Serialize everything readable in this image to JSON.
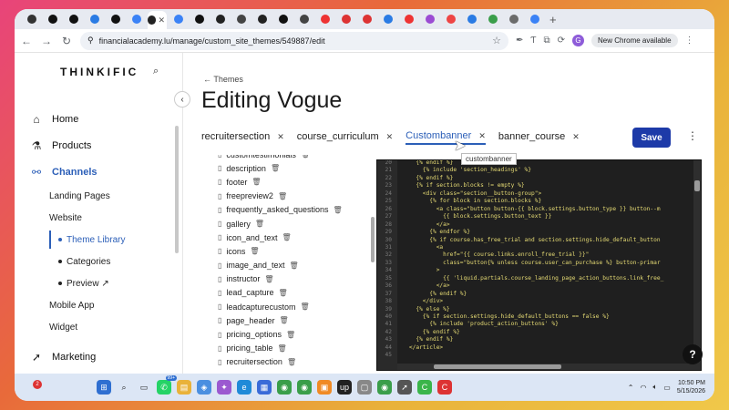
{
  "browser": {
    "url": "financialacademy.lu/manage/custom_site_themes/549887/edit",
    "new_chrome_label": "New Chrome available",
    "profile_initial": "G",
    "tab_favicons": [
      "#333",
      "#111",
      "#111",
      "#2a7be4",
      "#111",
      "#3b82f6",
      "#222",
      "#3b82f6",
      "#111",
      "#222",
      "#444",
      "#222",
      "#111",
      "#444",
      "#e33",
      "#d33",
      "#d33",
      "#2a7be4",
      "#e33",
      "#9b4bd3",
      "#e44",
      "#2a7be4",
      "#3a9e4a",
      "#6b6b6b",
      "#3b82f6"
    ]
  },
  "sidebar": {
    "logo": "THINKIFIC",
    "items": [
      {
        "label": "Home",
        "icon": "home-icon",
        "glyph": "⌂"
      },
      {
        "label": "Products",
        "icon": "products-icon",
        "glyph": "⚗"
      },
      {
        "label": "Channels",
        "icon": "channels-icon",
        "glyph": "⚯"
      }
    ],
    "channels_sub": [
      "Landing Pages",
      "Website"
    ],
    "website_sub": [
      "Theme Library",
      "Categories",
      "Preview ↗"
    ],
    "channels_sub_after": [
      "Mobile App",
      "Widget"
    ],
    "marketing": {
      "label": "Marketing",
      "glyph": "➚"
    }
  },
  "main": {
    "breadcrumb": "← Themes",
    "title": "Editing Vogue",
    "tabs": [
      "recruitersection",
      "course_curriculum",
      "Custombanner",
      "banner_course"
    ],
    "active_tab": 2,
    "save_label": "Save",
    "tooltip": "custombanner",
    "files": [
      "customtestimonials",
      "description",
      "footer",
      "freepreview2",
      "frequently_asked_questions",
      "gallery",
      "icon_and_text",
      "icons",
      "image_and_text",
      "instructor",
      "lead_capture",
      "leadcapturecustom",
      "page_header",
      "pricing_options",
      "pricing_table",
      "recruitersection"
    ],
    "code_lines": [
      {
        "n": "20",
        "t": "      {% endif %}"
      },
      {
        "n": "21",
        "t": "        {% include 'section_headings' %}"
      },
      {
        "n": "22",
        "t": "      {% endif %}"
      },
      {
        "n": "23",
        "t": "      {% if section.blocks != empty %}"
      },
      {
        "n": "24",
        "t": "        <div class=\"section__button-group\">"
      },
      {
        "n": "25",
        "t": "          {% for block in section.blocks %}"
      },
      {
        "n": "26",
        "t": "            <a class=\"button button-{{ block.settings.button_type }} button--m"
      },
      {
        "n": "27",
        "t": "              {{ block.settings.button_text }}"
      },
      {
        "n": "28",
        "t": "            </a>"
      },
      {
        "n": "29",
        "t": "          {% endfor %}"
      },
      {
        "n": "30",
        "t": "          {% if course.has_free_trial and section.settings.hide_default_button"
      },
      {
        "n": "31",
        "t": "            <a"
      },
      {
        "n": "32",
        "t": "              href=\"{{ course.links.enroll_free_trial }}\""
      },
      {
        "n": "33",
        "t": "              class=\"button{% unless course.user_can_purchase %} button-primar"
      },
      {
        "n": "34",
        "t": "            >"
      },
      {
        "n": "35",
        "t": "              {{ 'liquid.partials.course_landing_page_action_buttons.link_free_"
      },
      {
        "n": "36",
        "t": "            </a>"
      },
      {
        "n": "37",
        "t": "          {% endif %}"
      },
      {
        "n": "38",
        "t": "        </div>"
      },
      {
        "n": "39",
        "t": "      {% else %}"
      },
      {
        "n": "40",
        "t": "        {% if section.settings.hide_default_buttons == false %}"
      },
      {
        "n": "41",
        "t": "          {% include 'product_action_buttons' %}"
      },
      {
        "n": "42",
        "t": "        {% endif %}"
      },
      {
        "n": "43",
        "t": "      {% endif %}"
      },
      {
        "n": "44",
        "t": "    </article>"
      },
      {
        "n": "45",
        "t": ""
      }
    ],
    "help_label": "?"
  },
  "taskbar": {
    "apps": [
      {
        "name": "windows-start-icon",
        "color": "#2f6fd1",
        "glyph": "⊞"
      },
      {
        "name": "search-icon",
        "color": "#dce6f5",
        "glyph": "⌕"
      },
      {
        "name": "task-view-icon",
        "color": "#dce6f5",
        "glyph": "▭"
      },
      {
        "name": "whatsapp-icon",
        "color": "#25d366",
        "glyph": "✆",
        "badge": "99+"
      },
      {
        "name": "file-explorer-icon",
        "color": "#e9b23a",
        "glyph": "▤"
      },
      {
        "name": "photos-icon",
        "color": "#4a8fe0",
        "glyph": "◈"
      },
      {
        "name": "copilot-icon",
        "color": "#9b59d0",
        "glyph": "✦"
      },
      {
        "name": "edge-icon",
        "color": "#1f8ad8",
        "glyph": "e"
      },
      {
        "name": "store-icon",
        "color": "#3a6bd8",
        "glyph": "▦"
      },
      {
        "name": "chrome-icon",
        "color": "#3a9e4a",
        "glyph": "◉"
      },
      {
        "name": "chrome-profile-icon",
        "color": "#3a9e4a",
        "glyph": "◉"
      },
      {
        "name": "app-orange-icon",
        "color": "#f08a24",
        "glyph": "▣"
      },
      {
        "name": "upwork-icon",
        "color": "#222",
        "glyph": "up"
      },
      {
        "name": "app-grey-icon",
        "color": "#888",
        "glyph": "▢"
      },
      {
        "name": "chrome-alt-icon",
        "color": "#3a9e4a",
        "glyph": "◉"
      },
      {
        "name": "app-cursor-icon",
        "color": "#555",
        "glyph": "➚"
      },
      {
        "name": "camtasia-icon",
        "color": "#3ab54a",
        "glyph": "C"
      },
      {
        "name": "app-red-icon",
        "color": "#d33",
        "glyph": "C"
      }
    ],
    "notification_count": "2",
    "time": "10:50 PM",
    "date": "5/15/2026"
  }
}
